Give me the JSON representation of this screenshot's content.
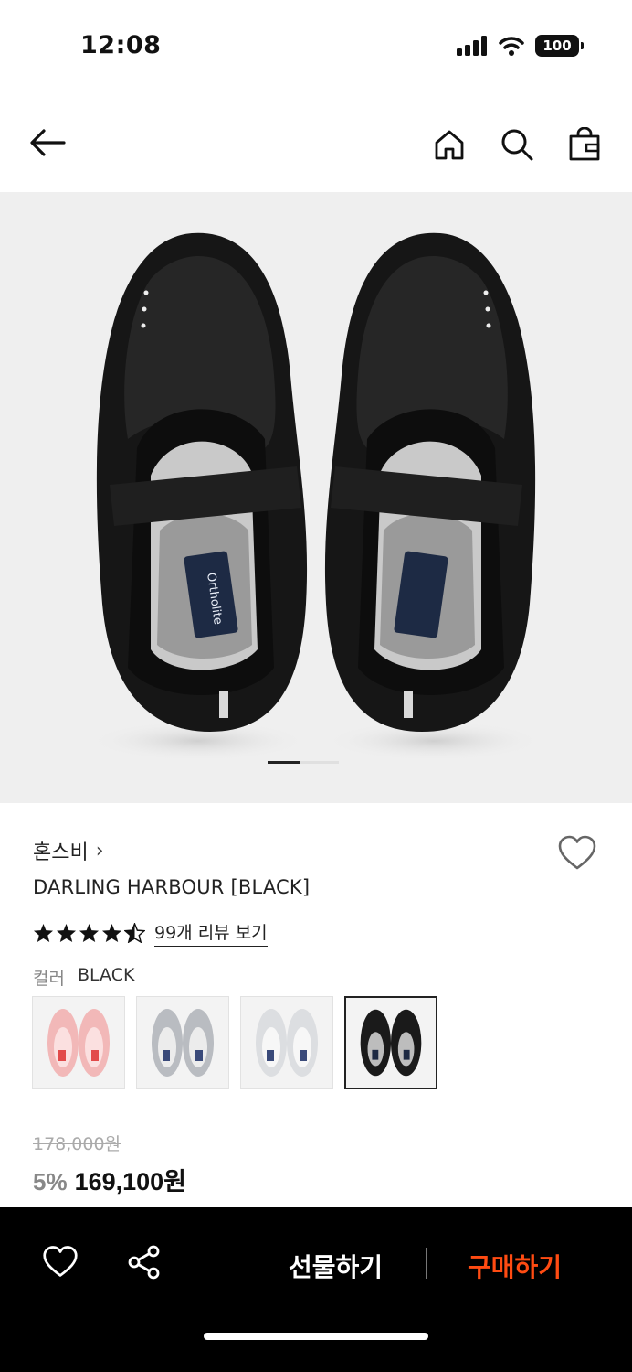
{
  "status": {
    "time": "12:08",
    "battery": "100"
  },
  "nav": {
    "icons": [
      "back-arrow-icon",
      "home-icon",
      "search-icon",
      "shopping-bag-icon"
    ]
  },
  "gallery": {
    "image": "black mary-jane sneakers top view",
    "insole_text": "Ortholite",
    "page_count": 2,
    "current_page": 1
  },
  "product": {
    "brand": "혼스비",
    "brand_chevron": "›",
    "name": "DARLING HARBOUR [BLACK]",
    "rating": 4.5,
    "review_link": "99개 리뷰 보기",
    "color_label": "컬러",
    "color_value": "BLACK",
    "swatches": [
      {
        "name": "pink",
        "color": "#f2b8b8"
      },
      {
        "name": "silver",
        "color": "#c9ccd0"
      },
      {
        "name": "white",
        "color": "#e7e8ea"
      },
      {
        "name": "black",
        "color": "#1a1a1a",
        "selected": true
      }
    ],
    "original_price": "178,000원",
    "discount": "5%",
    "final_price": "169,100원"
  },
  "bottom_bar": {
    "gift_label": "선물하기",
    "buy_label": "구매하기",
    "buy_color": "#ff4b12"
  }
}
